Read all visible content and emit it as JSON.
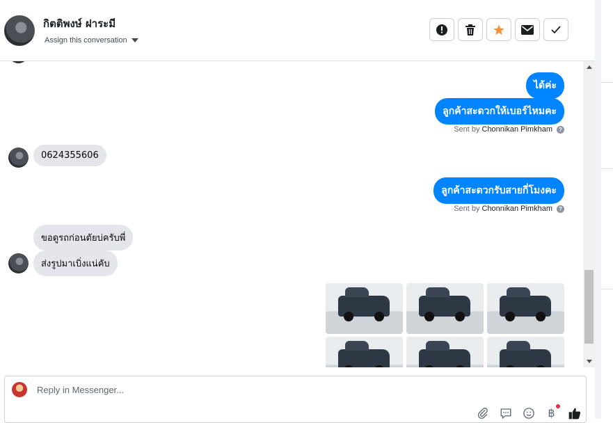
{
  "header": {
    "contact_name": "กิตติพงษ์ ฝาระมี",
    "assign_label": "Assign this conversation",
    "actions": [
      {
        "name": "mark-spam-button",
        "icon": "alert-circle-icon"
      },
      {
        "name": "delete-button",
        "icon": "trash-icon"
      },
      {
        "name": "star-button",
        "icon": "star-icon",
        "color": "#f7923b"
      },
      {
        "name": "mark-unread-button",
        "icon": "envelope-icon"
      },
      {
        "name": "mark-done-button",
        "icon": "check-icon"
      }
    ]
  },
  "thread": {
    "messages": [
      {
        "dir": "out",
        "text": "ได้ค่ะ"
      },
      {
        "dir": "out",
        "text": "ลูกค้าสะดวกให้เบอร์ไหมคะ",
        "sent_by_prefix": "Sent by",
        "sent_by_name": "Chonnikan Pimkham"
      },
      {
        "dir": "in",
        "text": "0624355606"
      },
      {
        "dir": "out",
        "text": "ลูกค้าสะดวกรับสายกี่โมงคะ",
        "sent_by_prefix": "Sent by",
        "sent_by_name": "Chonnikan Pimkham"
      },
      {
        "dir": "in",
        "text": "ขอดูรถก่อนตัยบ่ครับพี่"
      },
      {
        "dir": "in",
        "text": "ส่งรูปมาเบิ่งแน่คับ"
      }
    ],
    "photo_count": 6
  },
  "composer": {
    "placeholder": "Reply in Messenger...",
    "tools": [
      "paperclip-icon",
      "saved-reply-icon",
      "emoji-icon",
      "baht-payment-icon",
      "thumbs-up-icon"
    ]
  },
  "colors": {
    "outgoing_bubble": "#0084ff",
    "incoming_bubble": "#e4e6eb",
    "star_accent": "#f7923b"
  }
}
